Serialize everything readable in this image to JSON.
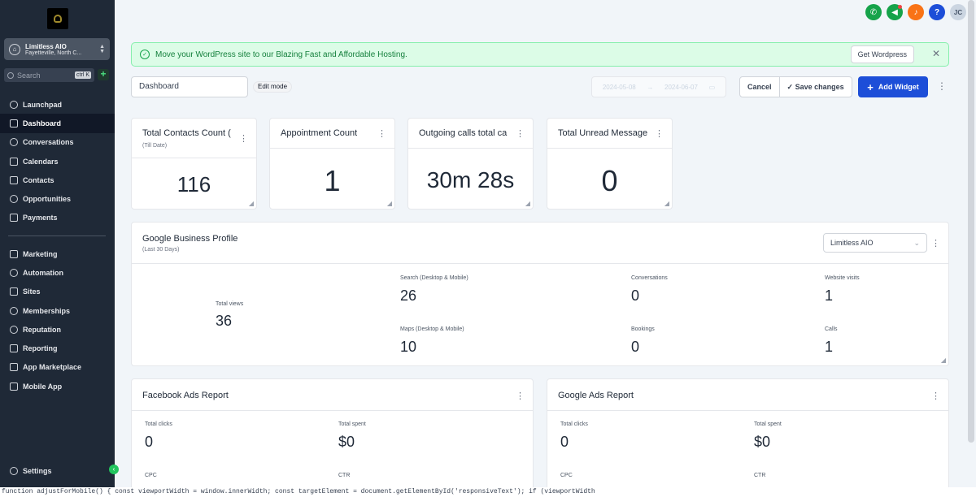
{
  "sidebar": {
    "location": {
      "name": "Limitless AIO",
      "city": "Fayetteville, North C..."
    },
    "search": {
      "placeholder": "Search",
      "shortcut": "ctrl K"
    },
    "items_top": [
      {
        "label": "Launchpad",
        "icon": "rocket-icon"
      },
      {
        "label": "Dashboard",
        "icon": "grid-icon",
        "active": true
      },
      {
        "label": "Conversations",
        "icon": "chat-icon"
      },
      {
        "label": "Calendars",
        "icon": "calendar-icon"
      },
      {
        "label": "Contacts",
        "icon": "contacts-icon"
      },
      {
        "label": "Opportunities",
        "icon": "funnel-icon"
      },
      {
        "label": "Payments",
        "icon": "payments-icon"
      }
    ],
    "items_bottom": [
      {
        "label": "Marketing",
        "icon": "send-icon"
      },
      {
        "label": "Automation",
        "icon": "automation-icon"
      },
      {
        "label": "Sites",
        "icon": "sites-icon"
      },
      {
        "label": "Memberships",
        "icon": "memberships-icon"
      },
      {
        "label": "Reputation",
        "icon": "star-icon"
      },
      {
        "label": "Reporting",
        "icon": "trend-icon"
      },
      {
        "label": "App Marketplace",
        "icon": "apps-icon"
      },
      {
        "label": "Mobile App",
        "icon": "mobile-icon"
      }
    ],
    "settings_label": "Settings"
  },
  "header": {
    "icons": [
      {
        "name": "phone-icon",
        "color": "#16a34a",
        "glyph": "✆"
      },
      {
        "name": "megaphone-icon",
        "color": "#16a34a",
        "glyph": "📣"
      },
      {
        "name": "bell-icon",
        "color": "#f97316",
        "glyph": "🔔"
      },
      {
        "name": "help-icon",
        "color": "#1d4ed8",
        "glyph": "?"
      }
    ],
    "avatar_initials": "JC"
  },
  "banner": {
    "message": "Move your WordPress site to our Blazing Fast and Affordable Hosting.",
    "button": "Get Wordpress",
    "close": "✕"
  },
  "toolbar": {
    "dashboard_name": "Dashboard",
    "edit_mode": "Edit mode",
    "date_start": "2024-05-08",
    "date_end": "2024-06-07",
    "date_arrow": "→",
    "cancel": "Cancel",
    "save": "Save changes",
    "add_widget": "Add Widget"
  },
  "stats": [
    {
      "title": "Total Contacts Count (",
      "subtitle": "(Till Date)",
      "value": "116"
    },
    {
      "title": "Appointment Count",
      "subtitle": "",
      "value": "1"
    },
    {
      "title": "Outgoing calls total ca",
      "subtitle": "",
      "value": "30m 28s"
    },
    {
      "title": "Total Unread Message",
      "subtitle": "",
      "value": "0"
    }
  ],
  "gbp": {
    "title": "Google Business Profile",
    "subtitle": "(Last 30 Days)",
    "location_select": "Limitless AIO",
    "total_views_label": "Total views",
    "total_views": "36",
    "metrics": [
      {
        "label": "Search (Desktop & Mobile)",
        "value": "26"
      },
      {
        "label": "Conversations",
        "value": "0"
      },
      {
        "label": "Website visits",
        "value": "1"
      },
      {
        "label": "Maps (Desktop & Mobile)",
        "value": "10"
      },
      {
        "label": "Bookings",
        "value": "0"
      },
      {
        "label": "Calls",
        "value": "1"
      }
    ]
  },
  "facebook_ads": {
    "title": "Facebook Ads Report",
    "clicks_label": "Total clicks",
    "clicks": "0",
    "spent_label": "Total spent",
    "spent": "$0",
    "cpc_label": "CPC",
    "ctr_label": "CTR"
  },
  "google_ads": {
    "title": "Google Ads Report",
    "clicks_label": "Total clicks",
    "clicks": "0",
    "spent_label": "Total spent",
    "spent": "$0",
    "cpc_label": "CPC",
    "ctr_label": "CTR"
  },
  "console_text": "function adjustForMobile() { const viewportWidth = window.innerWidth; const targetElement = document.getElementById('responsiveText'); if (viewportWidth"
}
